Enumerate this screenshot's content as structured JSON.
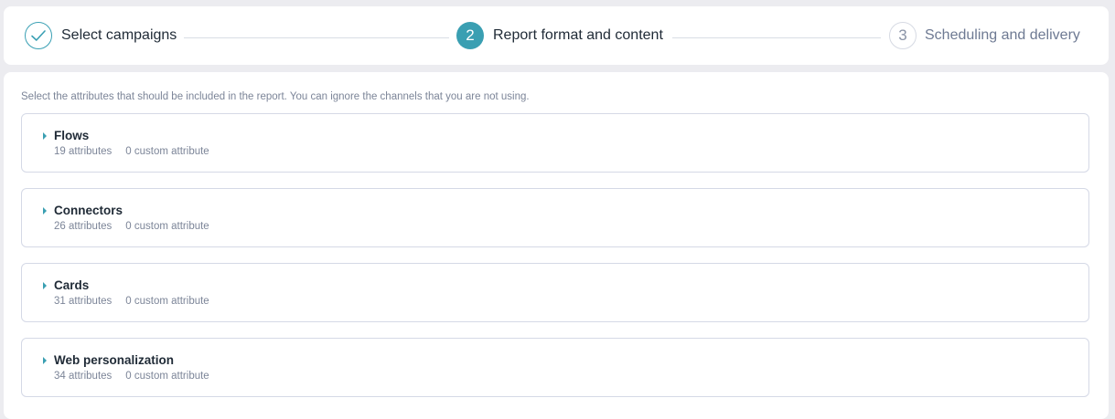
{
  "stepper": {
    "steps": [
      {
        "number": "1",
        "label": "Select campaigns",
        "state": "done"
      },
      {
        "number": "2",
        "label": "Report format and content",
        "state": "active"
      },
      {
        "number": "3",
        "label": "Scheduling and delivery",
        "state": "pending"
      }
    ]
  },
  "content": {
    "instructions": "Select the attributes that should be included in the report. You can ignore the channels that you are not using.",
    "groups": [
      {
        "title": "Flows",
        "attributes": "19 attributes",
        "custom": "0 custom attribute"
      },
      {
        "title": "Connectors",
        "attributes": "26 attributes",
        "custom": "0 custom attribute"
      },
      {
        "title": "Cards",
        "attributes": "31 attributes",
        "custom": "0 custom attribute"
      },
      {
        "title": "Web personalization",
        "attributes": "34 attributes",
        "custom": "0 custom attribute"
      }
    ]
  },
  "colors": {
    "accent": "#3a9fb2",
    "background": "#ececf0",
    "card": "#ffffff",
    "muted_text": "#7c8598"
  },
  "icons": {
    "done_step": "check-icon",
    "expand": "caret-right-icon"
  }
}
